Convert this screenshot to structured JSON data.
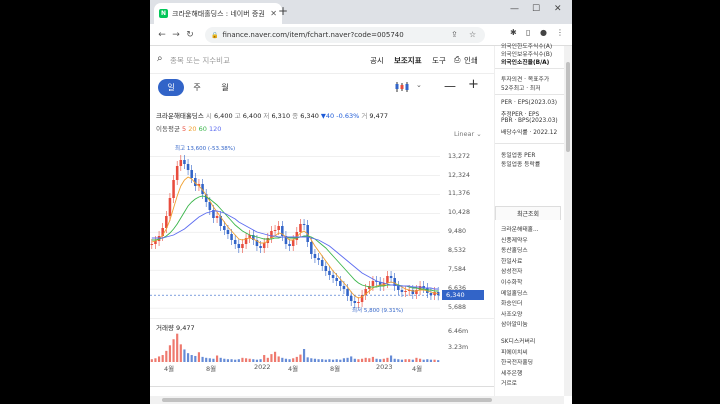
{
  "browser": {
    "tab_title": "크라운해태홀딩스 : 네이버 증권",
    "url": "finance.naver.com/item/fchart.naver?code=005740"
  },
  "search": {
    "placeholder": "종목 또는 지수비교"
  },
  "toolbar": {
    "disclosure": "공시",
    "indicators": "보조지표",
    "tools": "도구",
    "print": "인쇄"
  },
  "periods": {
    "day": "일",
    "week": "주",
    "month": "월",
    "active": "일"
  },
  "quote": {
    "name": "크라운해태홀딩스",
    "open_label": "시",
    "open": "6,400",
    "high_label": "고",
    "high": "6,400",
    "low_label": "저",
    "low": "6,310",
    "close_label": "종",
    "close": "6,340",
    "change": "▼40",
    "change_pct": "-0.63%",
    "vol_label": "거",
    "volume": "9,477"
  },
  "ma": {
    "label": "이동평균",
    "p5": "5",
    "p20": "20",
    "p60": "60",
    "p120": "120"
  },
  "scale_mode": "Linear",
  "chart_data": {
    "type": "line",
    "title": "",
    "y_ticks": [
      "13,272",
      "12,324",
      "11,376",
      "10,428",
      "9,480",
      "8,532",
      "7,584",
      "6,636",
      "5,688"
    ],
    "ylim": [
      5200,
      14000
    ],
    "x_ticks": [
      "4월",
      "8월",
      "2022",
      "4월",
      "8월",
      "2023",
      "4월"
    ],
    "current_price": "6,340",
    "high_marker": "최고 13,600 (-53.38%)",
    "low_marker": "최저 5,800 (9.31%)",
    "volume_label": "거래량",
    "volume_value": "9,477",
    "volume_ticks": [
      "6.46m",
      "3.23m"
    ],
    "series": [
      {
        "name": "5",
        "values": [
          8900,
          9050,
          9300,
          9700,
          10300,
          11200,
          12100,
          12800,
          13100,
          12900,
          12600,
          12200,
          11800,
          11900,
          11400,
          11000,
          10600,
          10200,
          10300,
          9800,
          9600,
          9400,
          9100,
          8900,
          8700,
          8900,
          9200,
          9350,
          9100,
          8800,
          8700,
          8950,
          9200,
          9550,
          9600,
          9800,
          9300,
          8900,
          8800,
          9100,
          9500,
          9900,
          9850,
          9000,
          8400,
          8200,
          8100,
          7800,
          7550,
          7350,
          7200,
          7050,
          6800,
          6650,
          6300,
          6050,
          5950,
          6000,
          6350,
          6650,
          6800,
          7050,
          7000,
          6800,
          6950,
          7300,
          7200,
          6800,
          6600,
          6500,
          6550,
          6600,
          6400,
          6600,
          6800,
          6700,
          6450,
          6350,
          6500,
          6340
        ]
      },
      {
        "name": "20",
        "values": [
          9000,
          9050,
          9150,
          9350,
          9650,
          10100,
          10700,
          11300,
          11800,
          12100,
          12250,
          12150,
          11950,
          11800,
          11600,
          11350,
          11050,
          10750,
          10500,
          10250,
          10000,
          9750,
          9550,
          9350,
          9150,
          9100,
          9150,
          9200,
          9150,
          9050,
          8950,
          8950,
          9050,
          9200,
          9300,
          9450,
          9400,
          9250,
          9100,
          9100,
          9250,
          9450,
          9550,
          9400,
          9100,
          8800,
          8550,
          8300,
          8050,
          7800,
          7550,
          7350,
          7150,
          6950,
          6750,
          6500,
          6300,
          6200,
          6250,
          6400,
          6550,
          6700,
          6800,
          6850,
          6850,
          6950,
          7000,
          6950,
          6850,
          6750,
          6650,
          6600,
          6550,
          6550,
          6600,
          6600,
          6550,
          6500,
          6450,
          6430
        ]
      },
      {
        "name": "60",
        "values": [
          9100,
          9100,
          9150,
          9200,
          9300,
          9450,
          9650,
          9900,
          10200,
          10500,
          10800,
          11000,
          11150,
          11250,
          11300,
          11250,
          11150,
          11000,
          10850,
          10650,
          10450,
          10250,
          10050,
          9850,
          9700,
          9550,
          9450,
          9350,
          9300,
          9250,
          9200,
          9150,
          9150,
          9150,
          9200,
          9200,
          9250,
          9250,
          9200,
          9200,
          9200,
          9250,
          9300,
          9300,
          9250,
          9150,
          9000,
          8850,
          8700,
          8500,
          8300,
          8100,
          7900,
          7700,
          7500,
          7300,
          7100,
          6950,
          6850,
          6800,
          6750,
          6750,
          6750,
          6800,
          6800,
          6850,
          6850,
          6850,
          6850,
          6800,
          6800,
          6750,
          6700,
          6700,
          6650,
          6650,
          6600,
          6600,
          6550,
          6550
        ]
      },
      {
        "name": "120",
        "values": [
          9200,
          9200,
          9200,
          9200,
          9250,
          9300,
          9350,
          9450,
          9550,
          9650,
          9800,
          9950,
          10100,
          10250,
          10350,
          10450,
          10500,
          10550,
          10550,
          10500,
          10450,
          10350,
          10250,
          10150,
          10000,
          9900,
          9800,
          9700,
          9600,
          9500,
          9450,
          9400,
          9350,
          9300,
          9300,
          9250,
          9250,
          9250,
          9250,
          9250,
          9250,
          9250,
          9250,
          9250,
          9200,
          9150,
          9100,
          9000,
          8900,
          8800,
          8650,
          8500,
          8350,
          8200,
          8050,
          7900,
          7750,
          7600,
          7450,
          7350,
          7250,
          7150,
          7050,
          7000,
          6950,
          6900,
          6850,
          6850,
          6800,
          6800,
          6800,
          6800,
          6750,
          6750,
          6750,
          6700,
          6700,
          6700,
          6650,
          6650
        ]
      }
    ],
    "volume": [
      0.6,
      0.8,
      1.2,
      1.5,
      2.4,
      3.6,
      4.9,
      6.1,
      3.8,
      2.7,
      1.9,
      1.5,
      1.3,
      2.1,
      1.1,
      0.9,
      0.8,
      0.7,
      1.4,
      0.9,
      0.7,
      0.6,
      0.6,
      0.5,
      0.6,
      0.9,
      0.8,
      0.7,
      0.6,
      0.5,
      0.6,
      1.5,
      0.9,
      1.7,
      2.2,
      1.2,
      0.9,
      0.7,
      0.6,
      0.8,
      1.1,
      1.6,
      2.8,
      1.0,
      0.8,
      0.7,
      0.6,
      0.6,
      0.5,
      0.6,
      0.5,
      0.6,
      0.5,
      0.8,
      0.9,
      1.2,
      0.7,
      0.6,
      0.7,
      0.9,
      0.8,
      1.1,
      0.7,
      0.6,
      0.7,
      0.9,
      1.4,
      0.7,
      0.6,
      0.5,
      0.6,
      0.6,
      0.5,
      0.9,
      0.7,
      0.5,
      0.6,
      0.5,
      0.5,
      0.4
    ],
    "colors": {
      "ma5": "#e84c3d",
      "ma20": "#f0a030",
      "ma60": "#39b54a",
      "ma120": "#5c6cf0",
      "up": "#e84c3d",
      "down": "#3264c8"
    }
  },
  "sidebar": {
    "top_items": [
      "외국인한도주식수(A)",
      "외국인보유주식수(B)",
      "외국인소진율(B/A)"
    ],
    "opinion_label": "투자의견 · 목표주가",
    "opinion_sub": "52주최고 · 최저",
    "per_label": "PER · EPS(2023.03)",
    "est_per": "추정PER · EPS",
    "pbr_label": "PBR · BPS(2023.03)",
    "dividend": "배당수익률 · 2022.12",
    "sector_per": "동일업종 PER",
    "sector_change": "동일업종 등락률",
    "recent_title": "최근조회",
    "recent": [
      "크라운해태홀...",
      "신풍제약우",
      "동산홀딩스",
      "한일사료",
      "삼성전자",
      "이수화학",
      "메일홀딩스",
      "화승인더",
      "사조오양",
      "삼아알미늄",
      "SK디스커버리",
      "피에이치씨",
      "한국전자홀딩",
      "세주은행",
      "거르로"
    ]
  }
}
